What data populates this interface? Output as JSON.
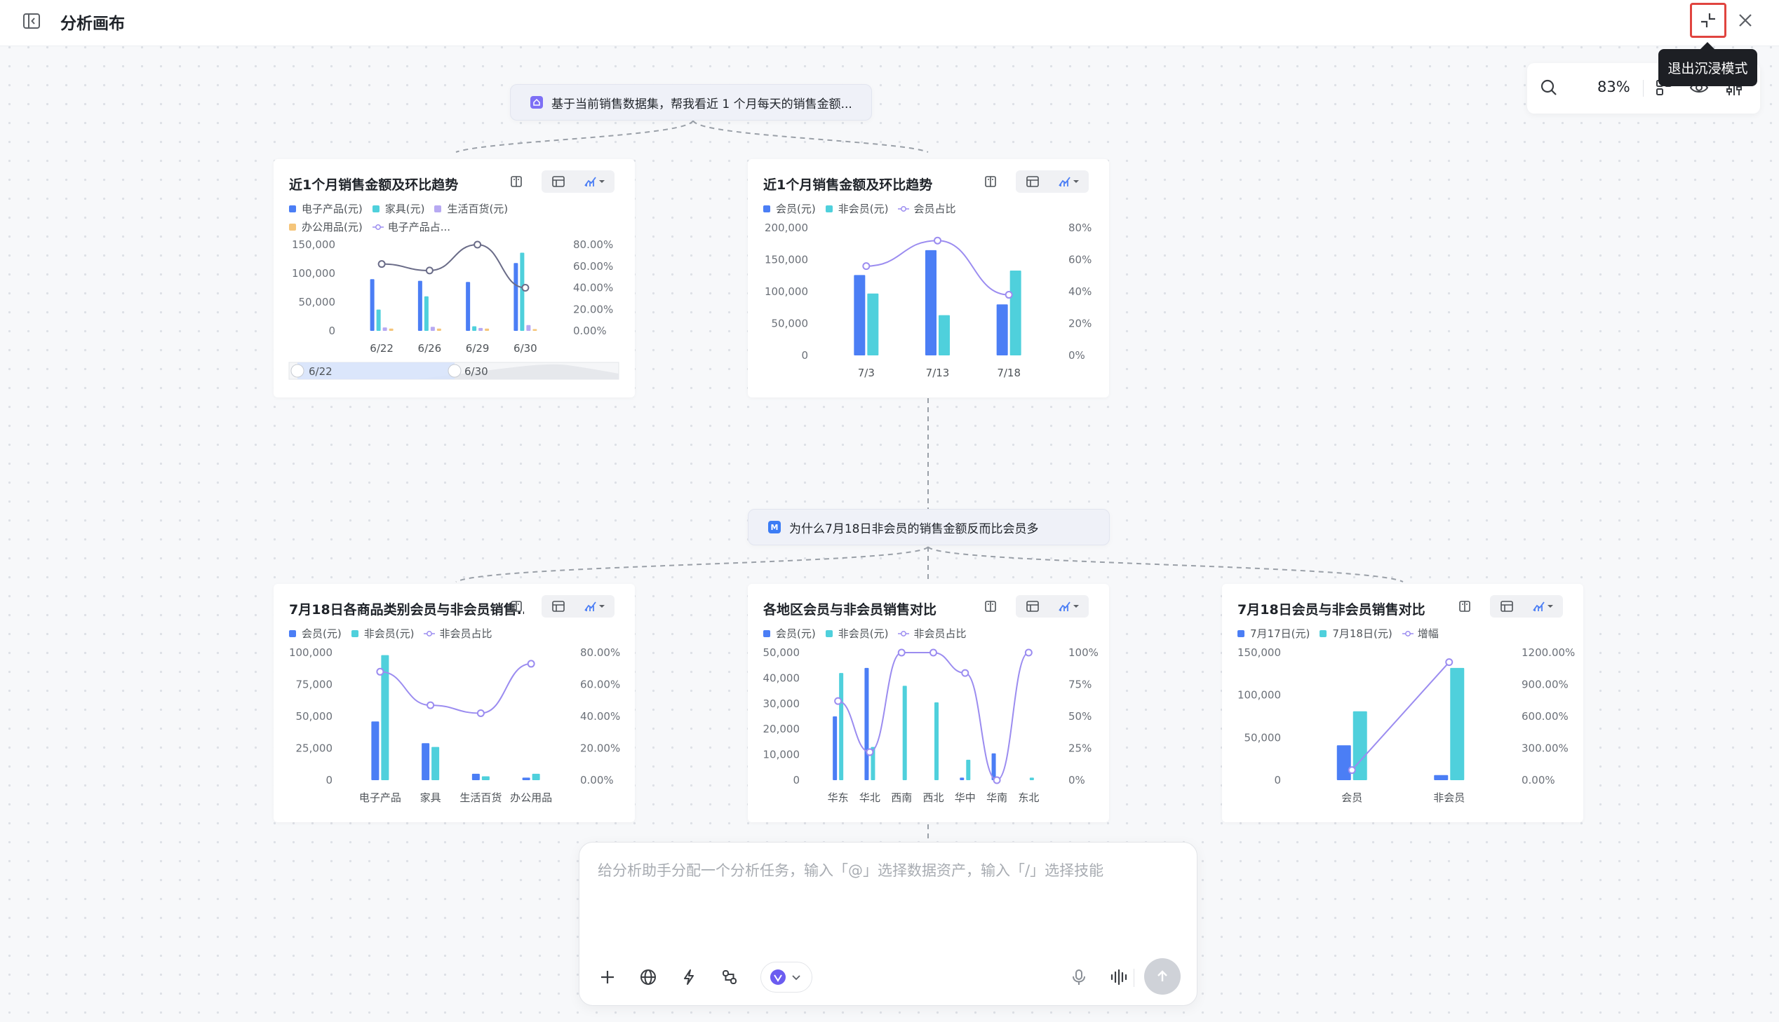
{
  "app": {
    "title": "分析画布",
    "tooltip": "退出沉浸模式",
    "zoom": "83%"
  },
  "prompts": [
    {
      "text": "基于当前销售数据集，帮我看近 1 个月每天的销售金额...",
      "icon_color": "#7d6ff5"
    },
    {
      "text": "为什么7月18日非会员的销售金额反而比会员多",
      "icon_color": "#3b7cf5",
      "icon_letter": "M"
    }
  ],
  "colors": {
    "blue": "#4b7ef5",
    "cyan": "#4fd0dc",
    "purple": "#9b8cf0",
    "orange": "#f5c57a",
    "lavender": "#b7a9f2"
  },
  "input": {
    "placeholder": "给分析助手分配一个分析任务，输入「@」选择数据资产，输入「/」选择技能"
  },
  "chart_data": [
    {
      "type": "bar",
      "title": "近1个月销售金额及环比趋势",
      "categories": [
        "6/22",
        "6/26",
        "6/29",
        "6/30"
      ],
      "series": [
        {
          "name": "电子产品(元)",
          "values": [
            90000,
            87000,
            85000,
            118000
          ]
        },
        {
          "name": "家具(元)",
          "values": [
            37000,
            60000,
            8000,
            136000
          ]
        },
        {
          "name": "生活百货(元)",
          "values": [
            6000,
            7000,
            5000,
            10000
          ]
        },
        {
          "name": "办公用品(元)",
          "values": [
            4000,
            4000,
            4000,
            3000
          ]
        },
        {
          "name": "电子产品占...",
          "type": "line",
          "axis": "right",
          "values": [
            62,
            56,
            80,
            40
          ]
        }
      ],
      "legend": [
        "电子产品(元)",
        "家具(元)",
        "生活百货(元)",
        "办公用品(元)",
        "电子产品占..."
      ],
      "y_ticks": [
        "150,000",
        "100,000",
        "50,000",
        "0"
      ],
      "y2_ticks": [
        "80.00%",
        "60.00%",
        "40.00%",
        "20.00%",
        "0.00%"
      ],
      "ylim": [
        0,
        150000
      ],
      "y2lim": [
        0,
        80
      ],
      "slider": {
        "start": "6/22",
        "end": "6/30"
      }
    },
    {
      "type": "bar",
      "title": "近1个月销售金额及环比趋势",
      "categories": [
        "7/3",
        "7/13",
        "7/18"
      ],
      "series": [
        {
          "name": "会员(元)",
          "values": [
            126000,
            165000,
            80000
          ]
        },
        {
          "name": "非会员(元)",
          "values": [
            97000,
            63000,
            133000
          ]
        },
        {
          "name": "会员占比",
          "type": "line",
          "axis": "right",
          "values": [
            56,
            72,
            38
          ]
        }
      ],
      "legend": [
        "会员(元)",
        "非会员(元)",
        "会员占比"
      ],
      "y_ticks": [
        "200,000",
        "150,000",
        "100,000",
        "50,000",
        "0"
      ],
      "y2_ticks": [
        "80%",
        "60%",
        "40%",
        "20%",
        "0%"
      ],
      "ylim": [
        0,
        200000
      ],
      "y2lim": [
        0,
        80
      ]
    },
    {
      "type": "bar",
      "title": "7月18日各商品类别会员与非会员销售...",
      "categories": [
        "电子产品",
        "家具",
        "生活百货",
        "办公用品"
      ],
      "series": [
        {
          "name": "会员(元)",
          "values": [
            46000,
            29000,
            5000,
            2000
          ]
        },
        {
          "name": "非会员(元)",
          "values": [
            98000,
            26000,
            3000,
            5000
          ]
        },
        {
          "name": "非会员占比",
          "type": "line",
          "axis": "right",
          "values": [
            68,
            47,
            42,
            73
          ]
        }
      ],
      "legend": [
        "会员(元)",
        "非会员(元)",
        "非会员占比"
      ],
      "y_ticks": [
        "100,000",
        "75,000",
        "50,000",
        "25,000",
        "0"
      ],
      "y2_ticks": [
        "80.00%",
        "60.00%",
        "40.00%",
        "20.00%",
        "0.00%"
      ],
      "ylim": [
        0,
        100000
      ],
      "y2lim": [
        0,
        80
      ]
    },
    {
      "type": "bar",
      "title": "各地区会员与非会员销售对比",
      "categories": [
        "华东",
        "华北",
        "西南",
        "西北",
        "华中",
        "华南",
        "东北"
      ],
      "series": [
        {
          "name": "会员(元)",
          "values": [
            25000,
            44000,
            0,
            0,
            1000,
            10500,
            0
          ]
        },
        {
          "name": "非会员(元)",
          "values": [
            42000,
            13000,
            37000,
            30500,
            8000,
            0,
            1000
          ]
        },
        {
          "name": "非会员占比",
          "type": "line",
          "axis": "right",
          "values": [
            62,
            22,
            100,
            100,
            84,
            0,
            100
          ]
        }
      ],
      "legend": [
        "会员(元)",
        "非会员(元)",
        "非会员占比"
      ],
      "y_ticks": [
        "50,000",
        "40,000",
        "30,000",
        "20,000",
        "10,000",
        "0"
      ],
      "y2_ticks": [
        "100%",
        "75%",
        "50%",
        "25%",
        "0%"
      ],
      "ylim": [
        0,
        50000
      ],
      "y2lim": [
        0,
        100
      ]
    },
    {
      "type": "bar",
      "title": "7月18日会员与非会员销售对比",
      "categories": [
        "会员",
        "非会员"
      ],
      "series": [
        {
          "name": "7月17日(元)",
          "values": [
            41000,
            6000
          ]
        },
        {
          "name": "7月18日(元)",
          "values": [
            81000,
            132000
          ]
        },
        {
          "name": "增幅",
          "type": "line",
          "axis": "right",
          "values": [
            95,
            1110
          ]
        }
      ],
      "legend": [
        "7月17日(元)",
        "7月18日(元)",
        "增幅"
      ],
      "y_ticks": [
        "150,000",
        "100,000",
        "50,000",
        "0"
      ],
      "y2_ticks": [
        "1200.00%",
        "900.00%",
        "600.00%",
        "300.00%",
        "0.00%"
      ],
      "ylim": [
        0,
        150000
      ],
      "y2lim": [
        0,
        1200
      ]
    }
  ]
}
